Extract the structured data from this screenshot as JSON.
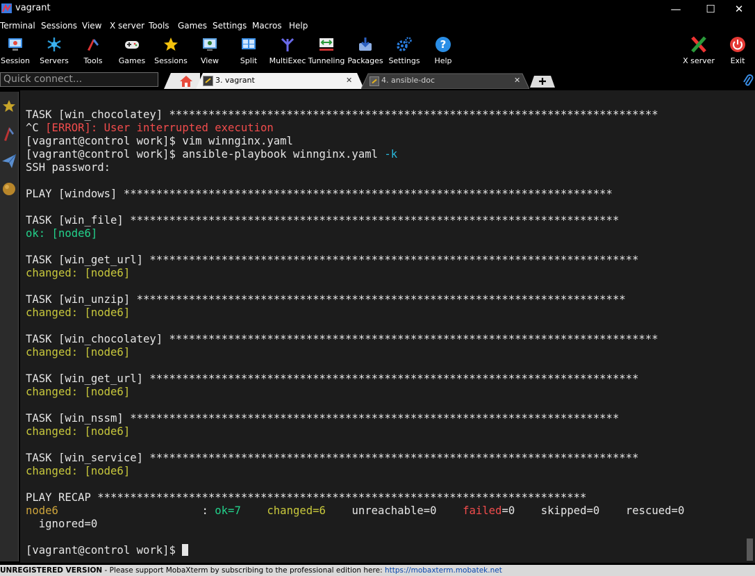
{
  "window": {
    "title": "vagrant",
    "minimize": "—",
    "maximize": "☐",
    "close": "✕"
  },
  "menu": [
    "Terminal",
    "Sessions",
    "View",
    "X server",
    "Tools",
    "Games",
    "Settings",
    "Macros",
    "Help"
  ],
  "toolbar": [
    {
      "label": "Session",
      "icon": "session-icon"
    },
    {
      "label": "Servers",
      "icon": "servers-icon"
    },
    {
      "label": "Tools",
      "icon": "tools-icon"
    },
    {
      "label": "Games",
      "icon": "games-icon"
    },
    {
      "label": "Sessions",
      "icon": "star-icon"
    },
    {
      "label": "View",
      "icon": "view-icon"
    },
    {
      "label": "Split",
      "icon": "split-icon"
    },
    {
      "label": "MultiExec",
      "icon": "multiexec-icon"
    },
    {
      "label": "Tunneling",
      "icon": "tunneling-icon"
    },
    {
      "label": "Packages",
      "icon": "packages-icon"
    },
    {
      "label": "Settings",
      "icon": "settings-icon"
    },
    {
      "label": "Help",
      "icon": "help-icon"
    }
  ],
  "right_toolbar": [
    {
      "label": "X server",
      "icon": "xserver-icon"
    },
    {
      "label": "Exit",
      "icon": "power-icon"
    }
  ],
  "quick_connect": {
    "placeholder": "Quick connect..."
  },
  "tabs": [
    {
      "label": "3. vagrant",
      "active": true,
      "close": "✕"
    },
    {
      "label": "4. ansible-doc",
      "active": false,
      "close": "✕"
    }
  ],
  "terminal": {
    "stars": "***************************************************************************",
    "l1_task": "TASK [win_chocolatey] ",
    "l2_prefix": "^C ",
    "l2_error": "[ERROR]: User interrupted execution",
    "l3": "[vagrant@control work]$ vim winnginx.yaml",
    "l4_prefix": "[vagrant@control work]$ ansible-playbook winnginx.yaml ",
    "l4_flag": "-k",
    "l5": "SSH password:",
    "play": "PLAY [windows] ",
    "t_win_file": "TASK [win_file] ",
    "ok_node": "ok: [node6]",
    "t_win_get_url": "TASK [win_get_url] ",
    "changed_node": "changed: [node6]",
    "t_win_unzip": "TASK [win_unzip] ",
    "t_win_chocolatey": "TASK [win_chocolatey] ",
    "t_win_nssm": "TASK [win_nssm] ",
    "t_win_service": "TASK [win_service] ",
    "recap": "PLAY RECAP ",
    "recap_host": "node6",
    "recap_sep": "                      : ",
    "recap_ok": "ok=7",
    "recap_changed": "changed=6",
    "recap_unreachable": "unreachable=0",
    "recap_failed_word": "failed",
    "recap_failed_val": "=0",
    "recap_skipped": "skipped=0",
    "recap_rescued": "rescued=0",
    "recap_ignored": "  ignored=0",
    "prompt": "[vagrant@control work]$ "
  },
  "status": {
    "label": "UNREGISTERED VERSION",
    "text": " - Please support MobaXterm by subscribing to the professional edition here: ",
    "link": "https://mobaxterm.mobatek.net"
  }
}
